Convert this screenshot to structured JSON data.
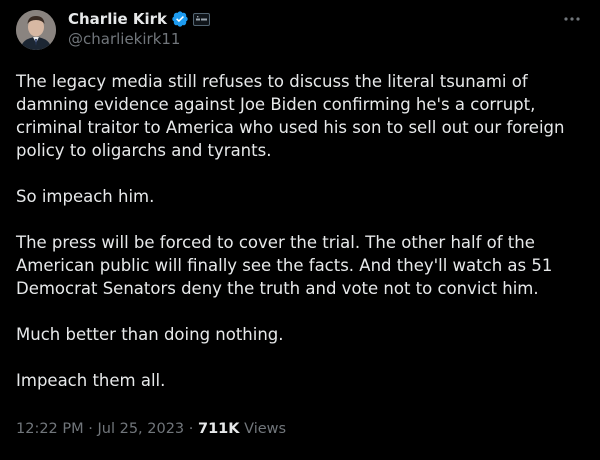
{
  "author": {
    "display_name": "Charlie Kirk",
    "handle": "@charliekirk11",
    "verified_color": "#1d9bf0",
    "verified_icon": "verified-badge-icon",
    "affiliation_icon": "affiliate-badge-icon"
  },
  "more_icon": "more-options-icon",
  "tweet": {
    "paragraphs": [
      "The legacy media still refuses to discuss the literal tsunami of damning evidence against Joe Biden confirming he's a corrupt, criminal traitor to America who used his son to sell out our foreign policy to oligarchs and tyrants.",
      "So impeach him.",
      "The press will be forced to cover the trial. The other half of the American public will finally see the facts. And they'll watch as 51 Democrat Senators deny the truth and vote not to convict him.",
      "Much better than doing nothing.",
      "Impeach them all."
    ]
  },
  "meta": {
    "time": "12:22 PM",
    "separator": "·",
    "date": "Jul 25, 2023",
    "views_count": "711K",
    "views_label": "Views"
  },
  "colors": {
    "background": "#000000",
    "text": "#e7e9ea",
    "muted": "#71767b",
    "accent": "#1d9bf0"
  }
}
